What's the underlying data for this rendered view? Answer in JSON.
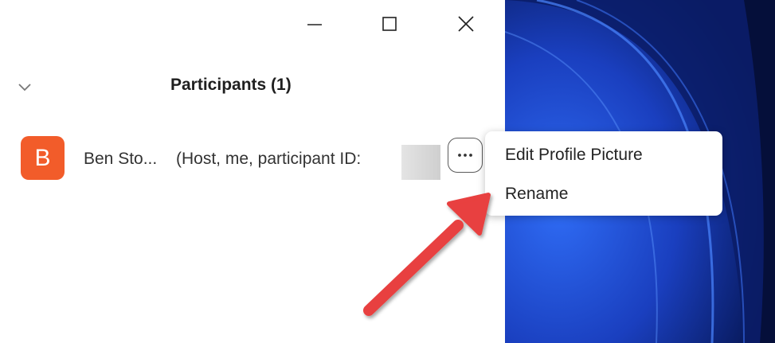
{
  "window": {
    "controls": [
      {
        "name": "minimize-icon",
        "label": "Minimize"
      },
      {
        "name": "maximize-icon",
        "label": "Maximize"
      },
      {
        "name": "close-icon",
        "label": "Close"
      }
    ]
  },
  "panel": {
    "title": "Participants (1)",
    "collapse_icon": "chevron-down-icon"
  },
  "participants": [
    {
      "initial": "B",
      "name": "Ben Sto...",
      "role": "(Host, me, participant ID:",
      "avatar_color": "#f25c2a"
    }
  ],
  "more_button": {
    "icon": "ellipsis-icon"
  },
  "context_menu": {
    "items": [
      {
        "label": "Edit Profile Picture"
      },
      {
        "label": "Rename"
      }
    ]
  },
  "annotation": {
    "arrow_color": "#e8413f",
    "target": "Rename"
  },
  "colors": {
    "wallpaper_base": "#0a1f75",
    "wallpaper_accent": "#1f57e8"
  }
}
